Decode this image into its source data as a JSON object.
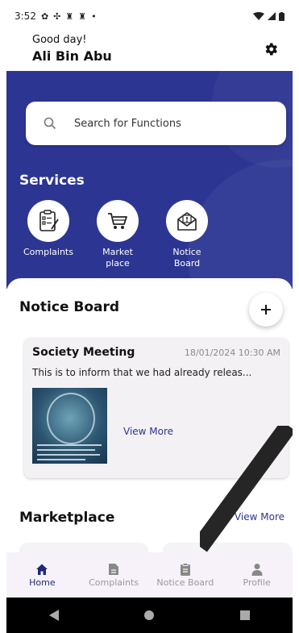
{
  "status_bar": {
    "time": "3:52",
    "notif_glyphs": [
      "✿",
      "✣",
      "♜",
      "♜",
      "•"
    ]
  },
  "header": {
    "greeting": "Good day!",
    "user_name": "Ali Bin Abu"
  },
  "search": {
    "placeholder": "Search for Functions"
  },
  "services": {
    "title": "Services",
    "items": [
      {
        "label_line1": "Complaints",
        "label_line2": "",
        "icon": "clipboard-checklist-icon"
      },
      {
        "label_line1": "Market",
        "label_line2": "place",
        "icon": "shopping-cart-icon"
      },
      {
        "label_line1": "Notice",
        "label_line2": "Board",
        "icon": "envelope-alert-icon"
      }
    ]
  },
  "notice_board": {
    "title": "Notice Board",
    "card": {
      "title": "Society Meeting",
      "date": "18/01/2024 10:30 AM",
      "body": "This is to inform that we had already releas...",
      "view_more": "View More"
    }
  },
  "marketplace": {
    "title": "Marketplace",
    "view_more": "View More"
  },
  "bottom_nav": {
    "items": [
      {
        "label": "Home",
        "icon": "home-icon",
        "active": true
      },
      {
        "label": "Complaints",
        "icon": "document-icon",
        "active": false
      },
      {
        "label": "Notice Board",
        "icon": "clipboard-icon",
        "active": false
      },
      {
        "label": "Profile",
        "icon": "person-icon",
        "active": false
      }
    ]
  },
  "colors": {
    "primary": "#2c3592",
    "nav_active": "#1e2a78"
  }
}
